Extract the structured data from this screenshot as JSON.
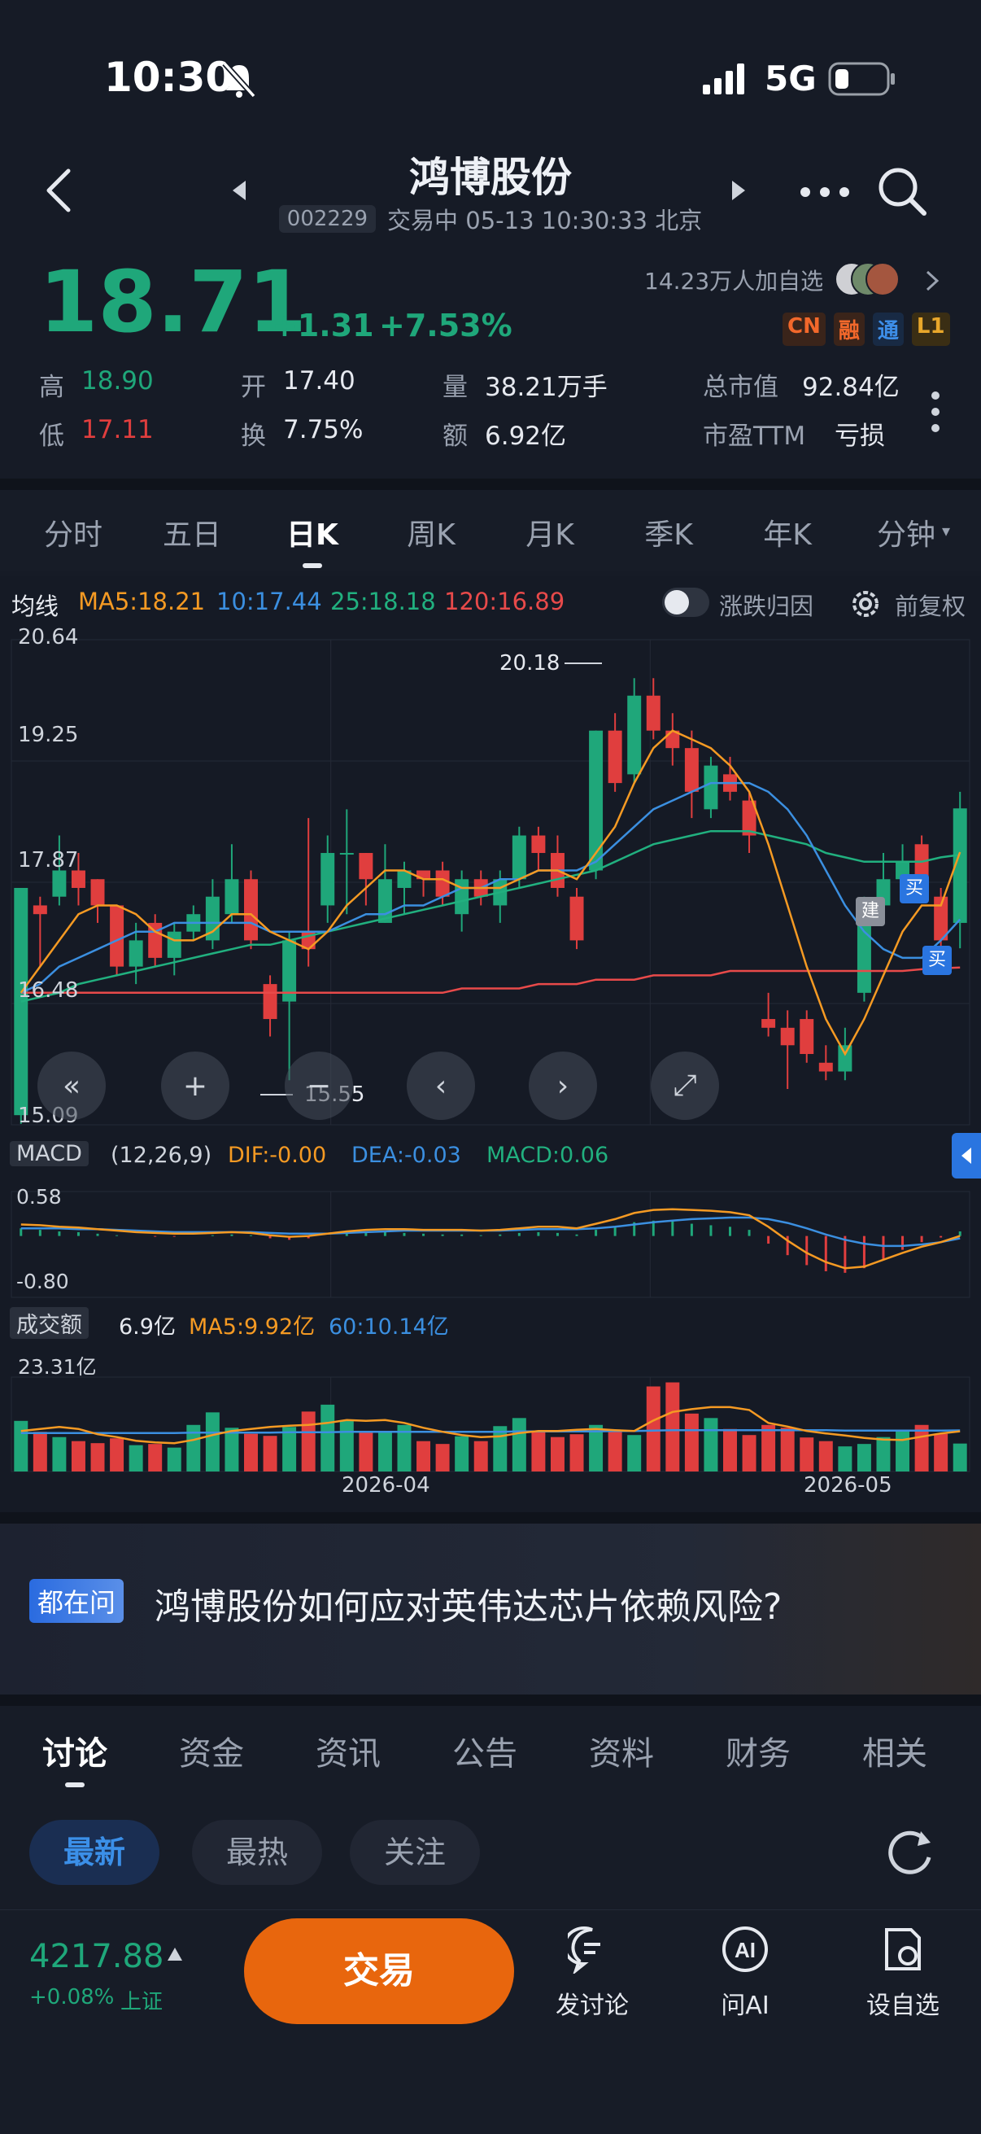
{
  "status_bar": {
    "time": "10:30",
    "network": "5G"
  },
  "header": {
    "title": "鸿博股份",
    "code": "002229",
    "market_status": "交易中 05-13 10:30:33 北京"
  },
  "quote": {
    "price": "18.71",
    "change": "+1.31",
    "change_pct": "+7.53%",
    "followers": "14.23万人加自选",
    "badges": [
      "CN",
      "融",
      "通",
      "L1"
    ],
    "stats": {
      "high_label": "高",
      "high": "18.90",
      "low_label": "低",
      "low": "17.11",
      "open_label": "开",
      "open": "17.40",
      "turnover_label": "换",
      "turnover": "7.75%",
      "volume_label": "量",
      "volume": "38.21万手",
      "amount_label": "额",
      "amount": "6.92亿",
      "mcap_label": "总市值",
      "mcap": "92.84亿",
      "pe_label": "市盈TTM",
      "pe": "亏损"
    }
  },
  "period_tabs": [
    "分时",
    "五日",
    "日K",
    "周K",
    "月K",
    "季K",
    "年K",
    "分钟"
  ],
  "active_period": "日K",
  "chart_header": {
    "label": "均线",
    "ma5": "MA5:18.21",
    "ma10": "10:17.44",
    "ma25": "25:18.18",
    "ma120": "120:16.89",
    "toggle_label": "涨跌归因",
    "adjust_label": "前复权"
  },
  "kline": {
    "y_ticks": [
      "20.64",
      "19.25",
      "17.87",
      "16.48",
      "15.09"
    ],
    "max_label": "20.18",
    "min_label": "15.55",
    "markers": [
      "建",
      "买",
      "买"
    ]
  },
  "macd": {
    "label": "MACD",
    "params": "(12,26,9)",
    "dif": "DIF:-0.00",
    "dea": "DEA:-0.03",
    "macd": "MACD:0.06",
    "y_ticks": [
      "0.58",
      "-0.80"
    ]
  },
  "volume": {
    "label": "成交额",
    "value": "6.9亿",
    "ma5": "MA5:9.92亿",
    "ma60": "60:10.14亿",
    "y_tick": "23.31亿",
    "x_labels": [
      "2026-04",
      "2026-05"
    ]
  },
  "chart_data": {
    "type": "candlestick",
    "ylim": [
      15.09,
      20.64
    ],
    "candles": [
      {
        "o": 15.2,
        "c": 17.8,
        "h": 17.8,
        "l": 15.1
      },
      {
        "o": 17.6,
        "c": 17.5,
        "h": 17.7,
        "l": 16.9
      },
      {
        "o": 17.7,
        "c": 18.0,
        "h": 18.4,
        "l": 17.6
      },
      {
        "o": 18.0,
        "c": 17.8,
        "h": 18.2,
        "l": 17.6
      },
      {
        "o": 17.9,
        "c": 17.6,
        "h": 17.9,
        "l": 17.4
      },
      {
        "o": 17.6,
        "c": 16.9,
        "h": 17.6,
        "l": 16.8
      },
      {
        "o": 16.9,
        "c": 17.2,
        "h": 17.4,
        "l": 16.7
      },
      {
        "o": 17.4,
        "c": 17.0,
        "h": 17.5,
        "l": 16.9
      },
      {
        "o": 17.0,
        "c": 17.3,
        "h": 17.4,
        "l": 16.8
      },
      {
        "o": 17.3,
        "c": 17.5,
        "h": 17.6,
        "l": 17.2
      },
      {
        "o": 17.2,
        "c": 17.7,
        "h": 17.9,
        "l": 17.1
      },
      {
        "o": 17.5,
        "c": 17.9,
        "h": 18.3,
        "l": 17.4
      },
      {
        "o": 17.9,
        "c": 17.2,
        "h": 18.0,
        "l": 17.1
      },
      {
        "o": 16.7,
        "c": 16.3,
        "h": 16.8,
        "l": 16.1
      },
      {
        "o": 16.5,
        "c": 17.2,
        "h": 17.3,
        "l": 15.6
      },
      {
        "o": 17.3,
        "c": 17.1,
        "h": 18.6,
        "l": 16.9
      },
      {
        "o": 17.6,
        "c": 18.2,
        "h": 18.4,
        "l": 17.4
      },
      {
        "o": 18.2,
        "c": 18.2,
        "h": 18.7,
        "l": 17.5
      },
      {
        "o": 18.2,
        "c": 17.9,
        "h": 18.2,
        "l": 17.6
      },
      {
        "o": 17.4,
        "c": 17.9,
        "h": 18.3,
        "l": 17.4
      },
      {
        "o": 17.8,
        "c": 18.0,
        "h": 18.1,
        "l": 17.5
      },
      {
        "o": 18.0,
        "c": 17.9,
        "h": 18.0,
        "l": 17.7
      },
      {
        "o": 18.0,
        "c": 17.7,
        "h": 18.1,
        "l": 17.6
      },
      {
        "o": 17.5,
        "c": 17.9,
        "h": 18.0,
        "l": 17.3
      },
      {
        "o": 17.9,
        "c": 17.7,
        "h": 18.0,
        "l": 17.6
      },
      {
        "o": 17.6,
        "c": 17.9,
        "h": 18.0,
        "l": 17.4
      },
      {
        "o": 17.9,
        "c": 18.4,
        "h": 18.5,
        "l": 17.8
      },
      {
        "o": 18.4,
        "c": 18.2,
        "h": 18.5,
        "l": 18.0
      },
      {
        "o": 18.2,
        "c": 17.8,
        "h": 18.4,
        "l": 17.7
      },
      {
        "o": 17.7,
        "c": 17.2,
        "h": 17.8,
        "l": 17.1
      },
      {
        "o": 18.0,
        "c": 19.6,
        "h": 19.6,
        "l": 17.9
      },
      {
        "o": 19.6,
        "c": 19.0,
        "h": 19.8,
        "l": 18.9
      },
      {
        "o": 19.1,
        "c": 20.0,
        "h": 20.2,
        "l": 19.0
      },
      {
        "o": 20.0,
        "c": 19.6,
        "h": 20.2,
        "l": 19.5
      },
      {
        "o": 19.6,
        "c": 19.4,
        "h": 19.8,
        "l": 19.2
      },
      {
        "o": 19.4,
        "c": 18.9,
        "h": 19.6,
        "l": 18.6
      },
      {
        "o": 18.7,
        "c": 19.2,
        "h": 19.3,
        "l": 18.6
      },
      {
        "o": 19.1,
        "c": 18.9,
        "h": 19.3,
        "l": 18.8
      },
      {
        "o": 18.8,
        "c": 18.4,
        "h": 18.9,
        "l": 18.2
      },
      {
        "o": 16.3,
        "c": 16.2,
        "h": 16.6,
        "l": 16.1
      },
      {
        "o": 16.2,
        "c": 16.0,
        "h": 16.4,
        "l": 15.5
      },
      {
        "o": 16.3,
        "c": 15.9,
        "h": 16.4,
        "l": 15.8
      },
      {
        "o": 15.8,
        "c": 15.7,
        "h": 16.0,
        "l": 15.6
      },
      {
        "o": 15.7,
        "c": 16.0,
        "h": 16.2,
        "l": 15.6
      },
      {
        "o": 16.6,
        "c": 17.6,
        "h": 17.7,
        "l": 16.5
      },
      {
        "o": 17.6,
        "c": 17.9,
        "h": 18.2,
        "l": 17.5
      },
      {
        "o": 17.9,
        "c": 18.1,
        "h": 18.3,
        "l": 17.8
      },
      {
        "o": 18.3,
        "c": 17.9,
        "h": 18.4,
        "l": 17.8
      },
      {
        "o": 17.7,
        "c": 17.2,
        "h": 17.8,
        "l": 17.1
      },
      {
        "o": 17.4,
        "c": 18.71,
        "h": 18.9,
        "l": 17.11
      }
    ],
    "ma5": [
      16.6,
      16.9,
      17.2,
      17.5,
      17.6,
      17.6,
      17.5,
      17.3,
      17.2,
      17.2,
      17.3,
      17.5,
      17.5,
      17.3,
      17.2,
      17.1,
      17.3,
      17.6,
      17.8,
      18.0,
      18.0,
      17.9,
      17.9,
      17.8,
      17.8,
      17.8,
      17.9,
      18.0,
      18.0,
      17.9,
      18.2,
      18.5,
      19.0,
      19.4,
      19.6,
      19.5,
      19.4,
      19.2,
      18.9,
      18.3,
      17.6,
      16.9,
      16.3,
      15.9,
      16.3,
      16.8,
      17.3,
      17.6,
      17.6,
      18.21
    ],
    "ma10": [
      16.6,
      16.7,
      16.9,
      17.0,
      17.1,
      17.2,
      17.3,
      17.3,
      17.4,
      17.4,
      17.4,
      17.4,
      17.4,
      17.3,
      17.3,
      17.3,
      17.3,
      17.4,
      17.5,
      17.5,
      17.6,
      17.6,
      17.7,
      17.8,
      17.8,
      17.9,
      17.9,
      18.0,
      18.0,
      18.0,
      18.1,
      18.3,
      18.5,
      18.7,
      18.8,
      18.9,
      19.0,
      19.0,
      19.0,
      18.9,
      18.7,
      18.4,
      18.0,
      17.6,
      17.3,
      17.1,
      17.0,
      17.0,
      17.2,
      17.44
    ],
    "ma25": [
      16.5,
      16.55,
      16.6,
      16.7,
      16.75,
      16.8,
      16.85,
      16.9,
      16.95,
      17.0,
      17.05,
      17.1,
      17.15,
      17.15,
      17.2,
      17.25,
      17.3,
      17.35,
      17.4,
      17.45,
      17.5,
      17.55,
      17.6,
      17.65,
      17.7,
      17.75,
      17.8,
      17.85,
      17.9,
      17.95,
      18.0,
      18.1,
      18.2,
      18.3,
      18.35,
      18.4,
      18.45,
      18.45,
      18.45,
      18.4,
      18.35,
      18.3,
      18.2,
      18.15,
      18.1,
      18.1,
      18.1,
      18.1,
      18.15,
      18.18
    ],
    "ma120": [
      16.6,
      16.6,
      16.6,
      16.6,
      16.6,
      16.6,
      16.6,
      16.6,
      16.6,
      16.6,
      16.6,
      16.6,
      16.6,
      16.6,
      16.6,
      16.6,
      16.6,
      16.6,
      16.6,
      16.6,
      16.6,
      16.6,
      16.6,
      16.65,
      16.65,
      16.65,
      16.65,
      16.7,
      16.7,
      16.7,
      16.75,
      16.75,
      16.75,
      16.8,
      16.8,
      16.8,
      16.8,
      16.85,
      16.85,
      16.85,
      16.85,
      16.85,
      16.85,
      16.85,
      16.85,
      16.85,
      16.85,
      16.87,
      16.88,
      16.89
    ],
    "macd_ylim": [
      -0.8,
      0.58
    ],
    "macd_hist": [
      0.1,
      0.08,
      0.06,
      0.05,
      0.03,
      0.01,
      0.0,
      -0.01,
      -0.01,
      0.0,
      0.01,
      0.02,
      0.01,
      -0.03,
      -0.05,
      -0.03,
      0.0,
      0.03,
      0.05,
      0.05,
      0.04,
      0.03,
      0.02,
      0.02,
      0.01,
      0.02,
      0.04,
      0.05,
      0.04,
      0.02,
      0.08,
      0.12,
      0.18,
      0.2,
      0.19,
      0.16,
      0.14,
      0.12,
      0.08,
      -0.1,
      -0.25,
      -0.38,
      -0.46,
      -0.48,
      -0.42,
      -0.3,
      -0.18,
      -0.08,
      -0.02,
      0.06
    ],
    "dif": [
      0.15,
      0.14,
      0.12,
      0.11,
      0.09,
      0.07,
      0.05,
      0.04,
      0.03,
      0.03,
      0.04,
      0.05,
      0.04,
      0.01,
      -0.01,
      0.0,
      0.03,
      0.06,
      0.08,
      0.09,
      0.09,
      0.08,
      0.08,
      0.08,
      0.07,
      0.08,
      0.1,
      0.12,
      0.12,
      0.1,
      0.16,
      0.22,
      0.3,
      0.34,
      0.35,
      0.34,
      0.33,
      0.31,
      0.27,
      0.12,
      -0.06,
      -0.22,
      -0.34,
      -0.42,
      -0.4,
      -0.31,
      -0.22,
      -0.14,
      -0.08,
      0.0
    ],
    "dea": [
      0.1,
      0.1,
      0.1,
      0.09,
      0.09,
      0.08,
      0.07,
      0.06,
      0.05,
      0.05,
      0.05,
      0.05,
      0.05,
      0.04,
      0.03,
      0.03,
      0.03,
      0.04,
      0.05,
      0.06,
      0.07,
      0.07,
      0.07,
      0.07,
      0.07,
      0.07,
      0.08,
      0.09,
      0.09,
      0.09,
      0.1,
      0.12,
      0.15,
      0.18,
      0.2,
      0.22,
      0.23,
      0.24,
      0.24,
      0.22,
      0.17,
      0.1,
      0.02,
      -0.05,
      -0.1,
      -0.13,
      -0.13,
      -0.11,
      -0.08,
      -0.03
    ],
    "amount_ylim": [
      0,
      23.31
    ],
    "amount": [
      12.5,
      9.8,
      8.5,
      7.5,
      7.0,
      8.2,
      6.5,
      6.8,
      5.9,
      11.5,
      14.6,
      10.8,
      9.3,
      8.8,
      11.0,
      14.8,
      16.5,
      12.5,
      9.8,
      10.0,
      11.5,
      7.5,
      6.8,
      8.7,
      7.5,
      11.2,
      13.2,
      9.8,
      8.5,
      9.2,
      11.5,
      10.2,
      9.0,
      21.0,
      22.0,
      14.3,
      13.2,
      10.5,
      9.0,
      11.5,
      10.8,
      8.4,
      7.5,
      6.2,
      6.8,
      8.5,
      10.3,
      11.5,
      9.3,
      6.9
    ],
    "amount_ma5": [
      10,
      10.5,
      11,
      10.5,
      9.2,
      8.5,
      7.6,
      7.2,
      7.0,
      7.8,
      9.0,
      10.0,
      10.5,
      11.0,
      11.3,
      11.5,
      12.0,
      12.7,
      12.5,
      12.7,
      12.0,
      10.8,
      9.8,
      9.0,
      8.5,
      8.7,
      9.5,
      10.0,
      10.0,
      10.3,
      10.5,
      10.2,
      10.0,
      12.6,
      14.7,
      15.4,
      15.9,
      15.9,
      15.2,
      12.0,
      11.1,
      10.0,
      9.4,
      8.9,
      8.3,
      7.9,
      7.8,
      8.6,
      9.4,
      9.92
    ],
    "amount_ma60": [
      9.5,
      9.5,
      9.5,
      9.5,
      9.5,
      9.5,
      9.5,
      9.5,
      9.5,
      9.6,
      9.6,
      9.6,
      9.6,
      9.6,
      9.7,
      9.7,
      9.7,
      9.8,
      9.8,
      9.8,
      9.8,
      9.8,
      9.8,
      9.8,
      9.8,
      9.8,
      9.9,
      9.9,
      9.9,
      9.9,
      9.9,
      10.0,
      10.0,
      10.1,
      10.2,
      10.2,
      10.2,
      10.2,
      10.2,
      10.2,
      10.2,
      10.2,
      10.2,
      10.1,
      10.1,
      10.1,
      10.1,
      10.1,
      10.1,
      10.14
    ]
  },
  "news_banner": {
    "tag": "都在问",
    "text": "鸿博股份如何应对英伟达芯片依赖风险?"
  },
  "section_tabs": [
    "讨论",
    "资金",
    "资讯",
    "公告",
    "资料",
    "财务",
    "相关"
  ],
  "active_section": "讨论",
  "filters": [
    "最新",
    "最热",
    "关注"
  ],
  "active_filter": "最新",
  "bottom_bar": {
    "index_value": "4217.88",
    "index_change": "+0.08%",
    "index_name": "上证",
    "trade_label": "交易",
    "post_label": "发讨论",
    "ai_label": "问AI",
    "watch_label": "设自选"
  },
  "colors": {
    "up": "#e03e3e",
    "down": "#1fa77a",
    "ma5": "#f59a23",
    "ma10": "#3b8fe0",
    "ma25": "#21b07f",
    "ma120": "#e84a4a",
    "trade": "#e8660d"
  }
}
